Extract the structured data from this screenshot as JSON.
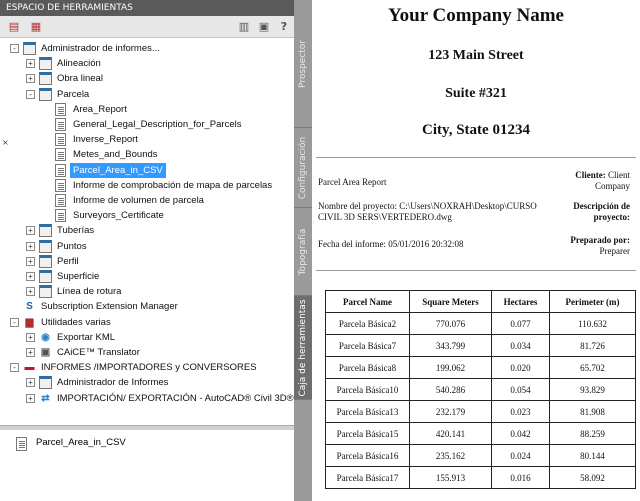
{
  "panel": {
    "title": "ESPACIO DE HERRAMIENTAS",
    "close_glyph": "×",
    "tree": [
      {
        "label": "Administrador de informes...",
        "icon": "folder-icon",
        "toggle": "-",
        "depth": 0
      },
      {
        "label": "Alineación",
        "icon": "folder-icon",
        "toggle": "+",
        "depth": 1
      },
      {
        "label": "Obra lineal",
        "icon": "folder-icon",
        "toggle": "+",
        "depth": 1
      },
      {
        "label": "Parcela",
        "icon": "folder-icon",
        "toggle": "-",
        "depth": 1
      },
      {
        "label": "Area_Report",
        "icon": "report-icon",
        "toggle": "",
        "depth": 2
      },
      {
        "label": "General_Legal_Description_for_Parcels",
        "icon": "report-icon",
        "toggle": "",
        "depth": 2
      },
      {
        "label": "Inverse_Report",
        "icon": "report-icon",
        "toggle": "",
        "depth": 2
      },
      {
        "label": "Metes_and_Bounds",
        "icon": "report-icon",
        "toggle": "",
        "depth": 2
      },
      {
        "label": "Parcel_Area_in_CSV",
        "icon": "report-icon",
        "toggle": "",
        "depth": 2,
        "selected": true
      },
      {
        "label": "Informe de comprobación de mapa de parcelas",
        "icon": "report-icon",
        "toggle": "",
        "depth": 2
      },
      {
        "label": "Informe de volumen de parcela",
        "icon": "report-icon",
        "toggle": "",
        "depth": 2
      },
      {
        "label": "Surveyors_Certificate",
        "icon": "report-icon",
        "toggle": "",
        "depth": 2
      },
      {
        "label": "Tuberías",
        "icon": "folder-icon",
        "toggle": "+",
        "depth": 1
      },
      {
        "label": "Puntos",
        "icon": "folder-icon",
        "toggle": "+",
        "depth": 1
      },
      {
        "label": "Perfil",
        "icon": "folder-icon",
        "toggle": "+",
        "depth": 1
      },
      {
        "label": "Superficie",
        "icon": "folder-icon",
        "toggle": "+",
        "depth": 1
      },
      {
        "label": "Línea de rotura",
        "icon": "folder-icon",
        "toggle": "+",
        "depth": 1
      },
      {
        "label": "Subscription Extension Manager",
        "icon": "subscription-icon",
        "toggle": "",
        "depth": 0
      },
      {
        "label": "Utilidades varias",
        "icon": "toolbox-icon",
        "toggle": "-",
        "depth": 0
      },
      {
        "label": "Exportar KML",
        "icon": "globe-icon",
        "toggle": "+",
        "depth": 1
      },
      {
        "label": "CAiCE™ Translator",
        "icon": "translator-icon",
        "toggle": "+",
        "depth": 1
      },
      {
        "label": "INFORMES /IMPORTADORES y CONVERSORES",
        "icon": "flag-icon",
        "toggle": "-",
        "depth": 0
      },
      {
        "label": "Administrador de Informes",
        "icon": "folder-icon",
        "toggle": "+",
        "depth": 1
      },
      {
        "label": "IMPORTACIÓN/ EXPORTACIÓN - AutoCAD® Civil 3D®...",
        "icon": "import-icon",
        "toggle": "+",
        "depth": 1
      }
    ],
    "detail_label": "Parcel_Area_in_CSV",
    "side_tabs": [
      "Prospector",
      "Configuración",
      "Topografía",
      "Caja de herramientas"
    ],
    "active_tab_index": 3
  },
  "report": {
    "company": "Your Company Name",
    "street": "123 Main Street",
    "suite": "Suite #321",
    "city": "City, State 01234",
    "report_title": "Parcel Area Report",
    "project_label": "Nombre del proyecto:",
    "project_value": "C:\\Users\\NOXRAH\\Desktop\\CURSO CIVIL 3D SERS\\VERTEDERO.dwg",
    "date_label": "Fecha del informe:",
    "date_value": "05/01/2016 20:32:08",
    "client_label": "Cliente:",
    "client_value": "Client Company",
    "desc_label": "Descripción de proyecto:",
    "prepared_label": "Preparado por:",
    "prepared_value": "Preparer",
    "table": {
      "headers": [
        "Parcel Name",
        "Square Meters",
        "Hectares",
        "Perimeter (m)"
      ],
      "rows": [
        [
          "Parcela Básica2",
          "770.076",
          "0.077",
          "110.632"
        ],
        [
          "Parcela Básica7",
          "343.799",
          "0.034",
          "81.726"
        ],
        [
          "Parcela Básica8",
          "199.062",
          "0.020",
          "65.702"
        ],
        [
          "Parcela Básica10",
          "540.286",
          "0.054",
          "93.829"
        ],
        [
          "Parcela Básica13",
          "232.179",
          "0.023",
          "81.908"
        ],
        [
          "Parcela Básica15",
          "420.141",
          "0.042",
          "88.259"
        ],
        [
          "Parcela Básica16",
          "235.162",
          "0.024",
          "80.144"
        ],
        [
          "Parcela Básica17",
          "155.913",
          "0.016",
          "58.092"
        ]
      ]
    }
  }
}
